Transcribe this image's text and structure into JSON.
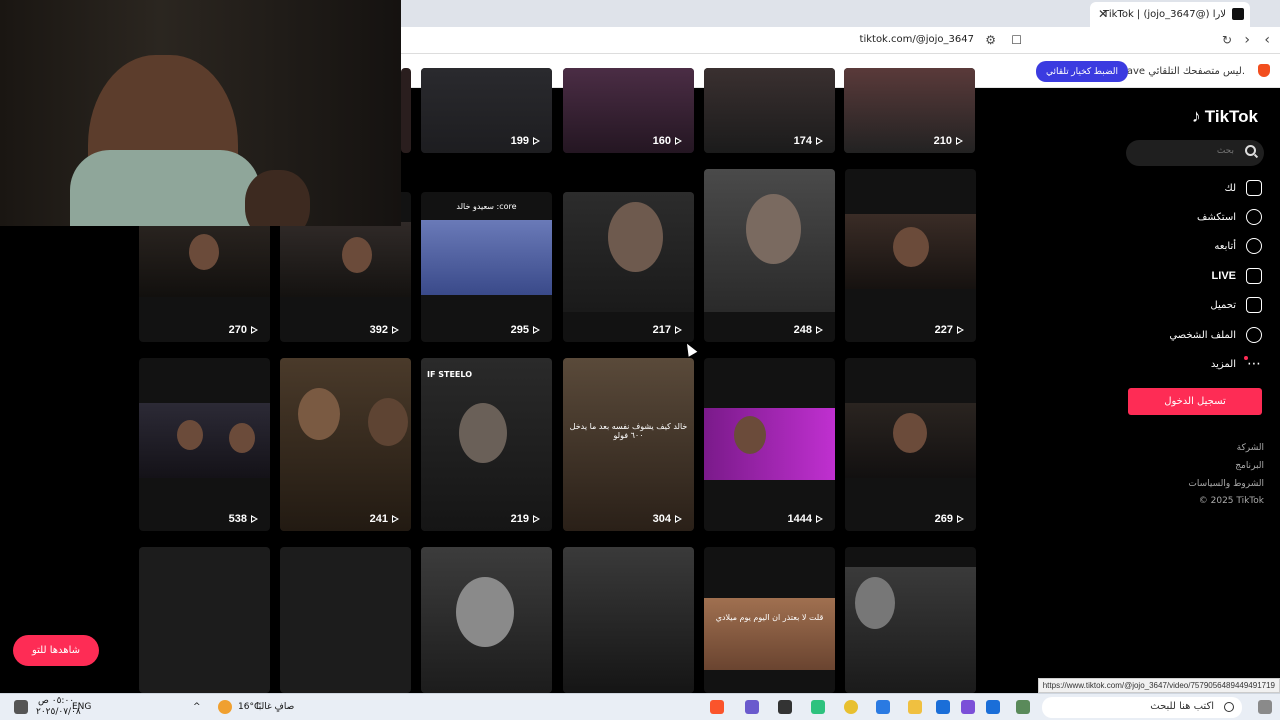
{
  "browser": {
    "tab_title": "TikTok | (jojo_3647@) لارا",
    "new_tab_symbol": "+",
    "close_symbol": "✕",
    "url": "tiktok.com/@jojo_3647",
    "infobar_text": "Brave ليس متصفحك التلقائي.",
    "infobar_button": "الضبط كخيار تلقائي"
  },
  "sidebar": {
    "logo": "TikTok",
    "search_placeholder": "بحث",
    "nav": [
      {
        "label": "لك",
        "icon": "home-icon"
      },
      {
        "label": "استكشف",
        "icon": "compass-icon"
      },
      {
        "label": "أتابعه",
        "icon": "user-plus-icon"
      },
      {
        "label": "LIVE",
        "icon": "live-tv-icon"
      },
      {
        "label": "تحميل",
        "icon": "upload-icon"
      },
      {
        "label": "الملف الشخصي",
        "icon": "profile-icon"
      },
      {
        "label": "المزيد",
        "icon": "more-dots-icon"
      }
    ],
    "login": "تسجيل الدخول",
    "footer": [
      "الشركة",
      "البرنامج",
      "الشروط والسياسات",
      "© 2025 TikTok"
    ]
  },
  "videos": {
    "row0": [
      "210",
      "174",
      "160",
      "199"
    ],
    "row1": [
      "227",
      "248",
      "217",
      "295",
      "392",
      "270"
    ],
    "row2": [
      "269",
      "1444",
      "304",
      "219",
      "241",
      "538"
    ],
    "row1_caption": "سعيدو خالد :core",
    "row2_caption_a": "خالد كيف يشوف نفسه بعد ما يدخل ٦٠٠ فولو",
    "row2_tag": "IF STEELO",
    "row3_caption": "قلت لا بعتذر ان اليوم يوم ميلادي"
  },
  "floating_button": "شاهدها للتو",
  "status_url": "https://www.tiktok.com/@jojo_3647/video/7579056489449491719",
  "taskbar": {
    "search": "اكتب هنا للبحث",
    "weather": "16°C",
    "weather_desc": "صافٍ غالبًا",
    "lang": "ENG",
    "time": "٠٥:٠٠ ص",
    "date": "٢٠٢٥/٠٧/٠٨"
  }
}
